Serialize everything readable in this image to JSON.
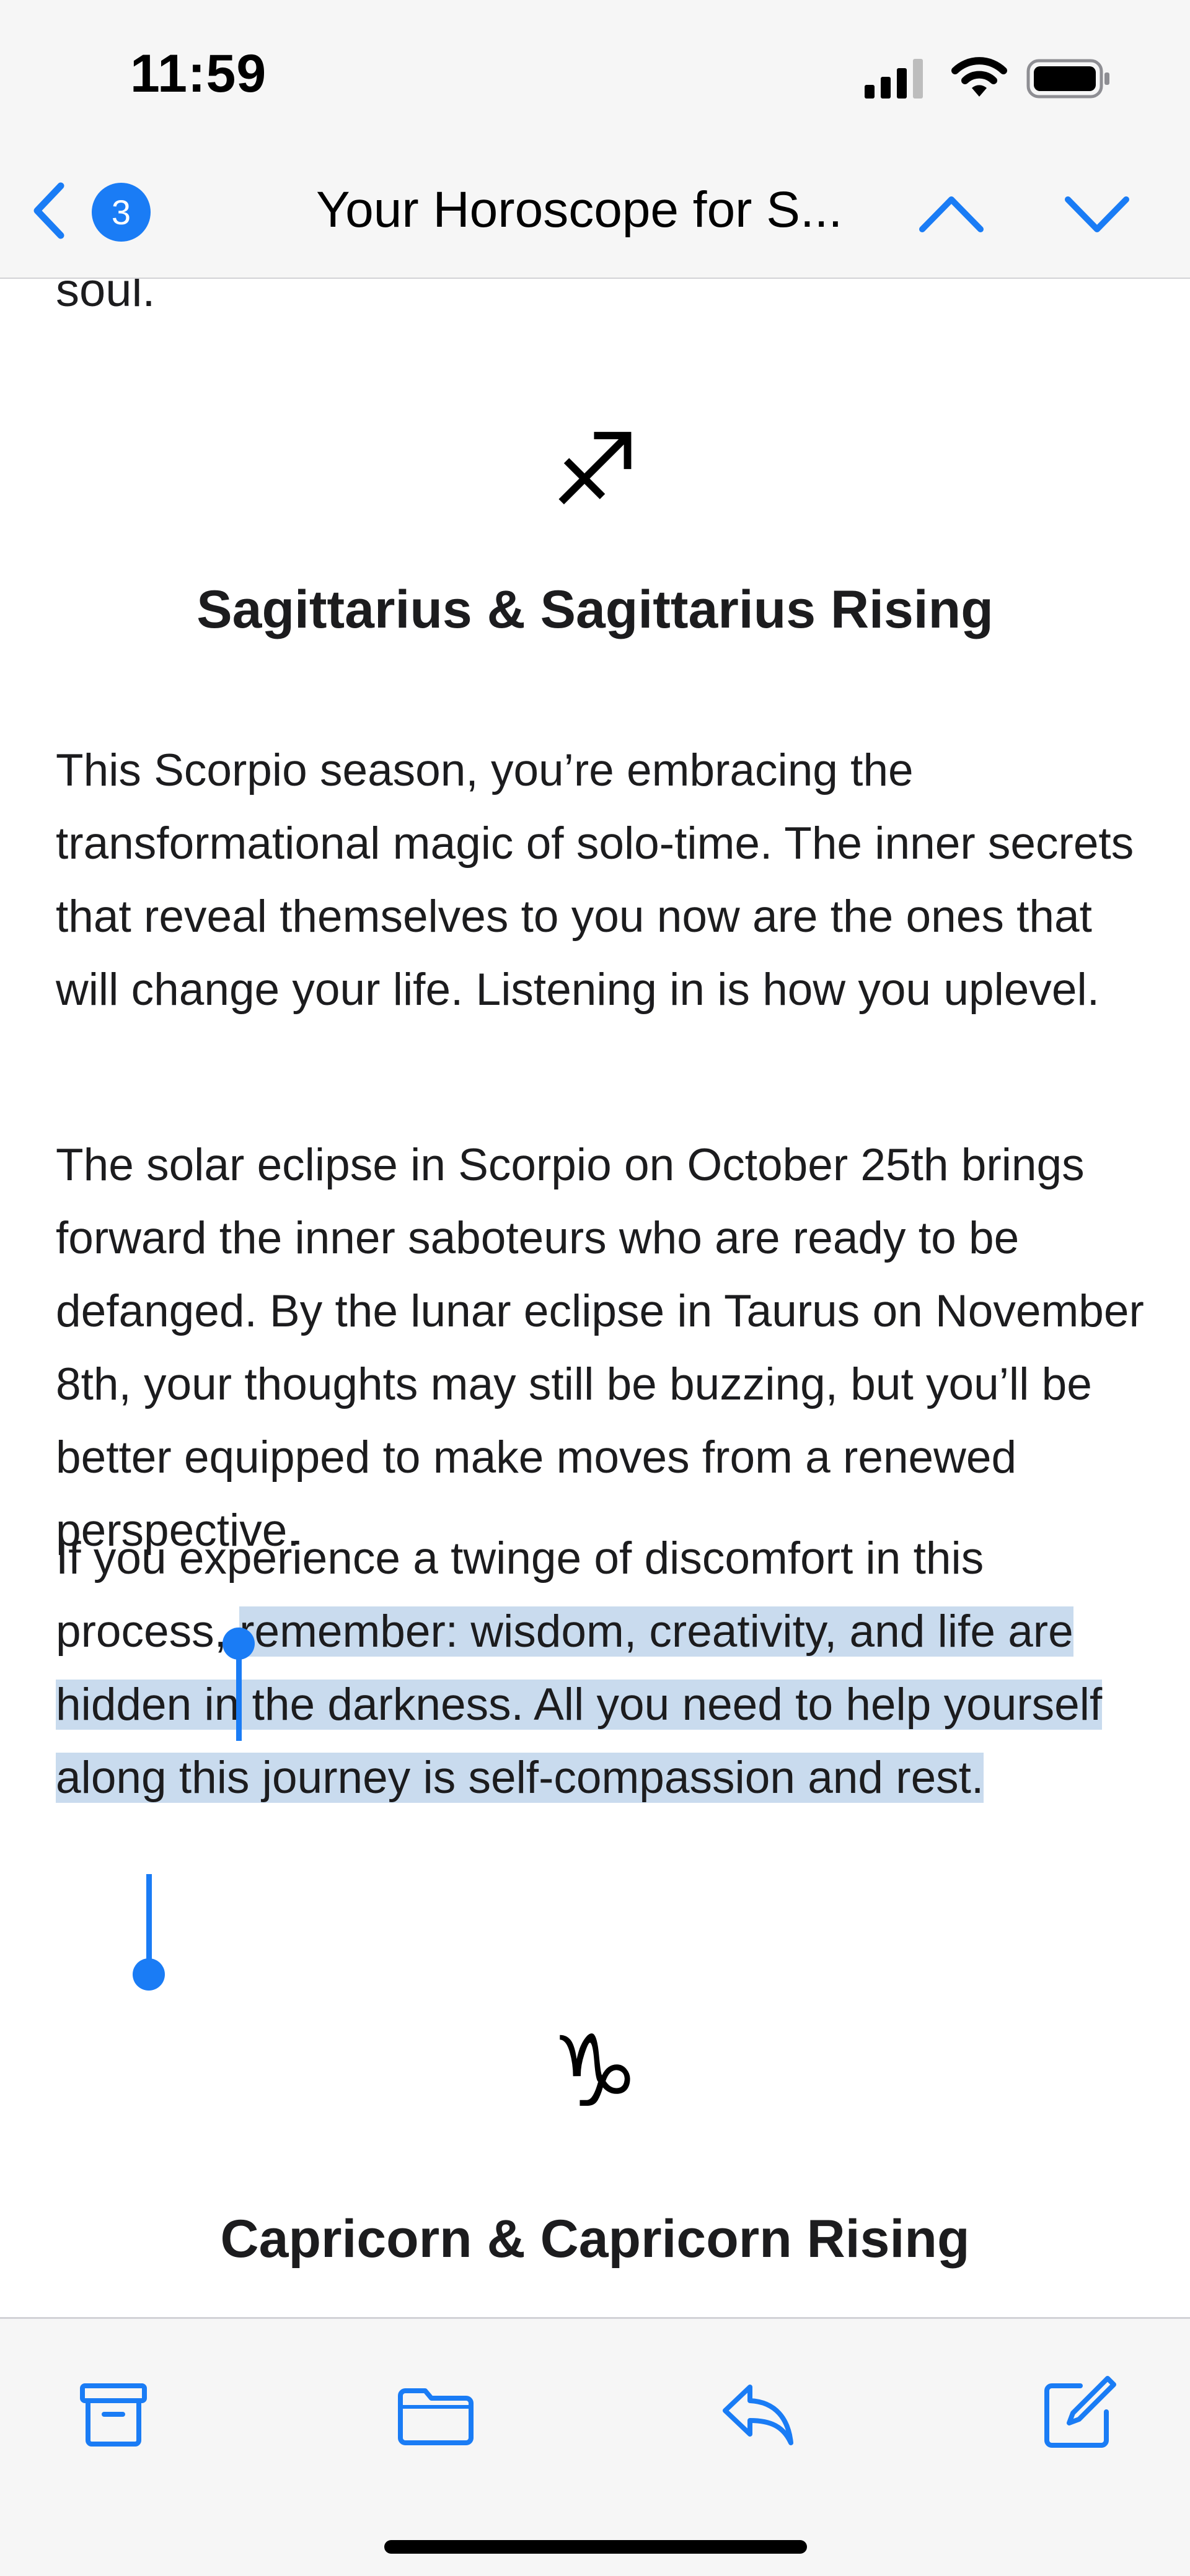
{
  "status_bar": {
    "time": "11:59",
    "icons": [
      "cellular-signal-icon",
      "wifi-icon",
      "battery-icon"
    ]
  },
  "nav": {
    "back_icon": "chevron-left-icon",
    "unread_count": "3",
    "title": "Your Horoscope for S...",
    "prev_message_icon": "chevron-up-icon",
    "next_message_icon": "chevron-down-icon"
  },
  "email": {
    "previous_text_tail": "soul.",
    "sections": [
      {
        "glyph": "♐",
        "heading": "Sagittarius & Sagittarius Rising",
        "paragraphs": [
          "This Scorpio season, you’re embracing the transformational magic of solo-time. The inner secrets that reveal themselves to you now are the ones that will change your life. Listening in is how you uplevel.",
          "The solar eclipse in Scorpio on October 25th brings forward the inner saboteurs who are ready to be defanged. By the lunar eclipse in Taurus on November 8th, your thoughts may still be buzzing, but you’ll be better equipped to make moves from a renewed perspective."
        ],
        "last_paragraph": {
          "before_selection": "If you experience a twinge of discomfort in this process, ",
          "selected": "remember: wisdom, creativity, and life are hidden in the darkness. All you need to help yourself along this journey is self-compassion and rest."
        }
      },
      {
        "glyph": "♑",
        "heading": "Capricorn & Capricorn Rising"
      }
    ]
  },
  "toolbar": {
    "buttons": [
      "archive-icon",
      "folder-icon",
      "reply-icon",
      "compose-icon"
    ]
  },
  "colors": {
    "accent": "#1a7cf5",
    "selection": "#c9dbee",
    "bar_background": "#f6f6f6"
  }
}
